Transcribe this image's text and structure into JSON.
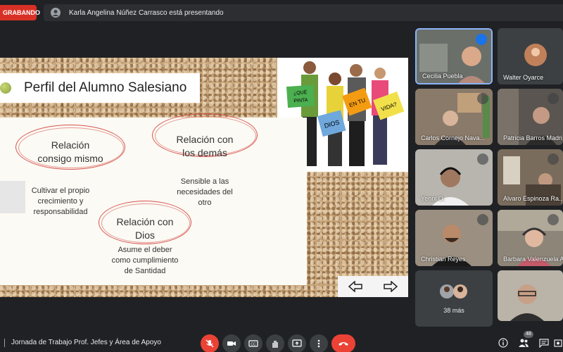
{
  "top": {
    "recording_label": "GRABANDO",
    "presenting_text": "Karla Angelina Núñez Carrasco está presentando"
  },
  "slide": {
    "title": "Perfil del Alumno Salesiano",
    "bubbles": [
      {
        "title_line1": "Relación",
        "title_line2": "consigo mismo",
        "desc": [
          "Cultivar el propio",
          "crecimiento y",
          "responsabilidad"
        ]
      },
      {
        "title_line1": "Relación con",
        "title_line2": "los demás",
        "desc": [
          "Sensible a las",
          "necesidades del",
          "otro"
        ]
      },
      {
        "title_line1": "Relación con",
        "title_line2": "Dios",
        "desc": [
          "Asume el deber",
          "como cumplimiento",
          "de Santidad"
        ]
      }
    ],
    "photo_signs": [
      "¿QUÉ",
      "PINTA",
      "DIOS",
      "EN TU",
      "VIDA?"
    ]
  },
  "participants": [
    {
      "name": "Cecilia Puebla",
      "state": "speaking",
      "bg": "#6b6f6a"
    },
    {
      "name": "Walter Oyarce",
      "state": "avatar",
      "bg": "#3c4043"
    },
    {
      "name": "Carlos Cornejo Nava...",
      "state": "muted",
      "bg": "#8a7a6a"
    },
    {
      "name": "Patricia Barros Madri...",
      "state": "muted",
      "bg": "#5a5550"
    },
    {
      "name": "Yenni O.",
      "state": "muted",
      "bg": "#b8b5ae"
    },
    {
      "name": "Alvaro Espinoza Ra...",
      "state": "muted",
      "bg": "#7a6c5c"
    },
    {
      "name": "Christian Reyes",
      "state": "muted",
      "bg": "#9a8f80"
    },
    {
      "name": "Barbara Valenzuela A...",
      "state": "muted",
      "bg": "#8d8578"
    },
    {
      "name": "38 más",
      "state": "more",
      "bg": "#3c4043"
    },
    {
      "name": "",
      "state": "video",
      "bg": "#b9b3a8"
    }
  ],
  "bottom": {
    "meeting_title": "Jornada de Trabajo Prof. Jefes y Área de Apoyo",
    "participant_count": "48"
  }
}
